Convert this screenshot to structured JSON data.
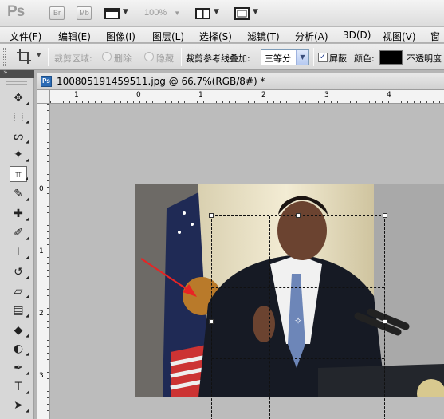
{
  "app": {
    "logo": "Ps",
    "bridge_btn": "Br",
    "minibridge_btn": "Mb",
    "zoom": "100%"
  },
  "menu": [
    "文件(F)",
    "编辑(E)",
    "图像(I)",
    "图层(L)",
    "选择(S)",
    "滤镜(T)",
    "分析(A)",
    "3D(D)",
    "视图(V)",
    "窗"
  ],
  "options": {
    "crop_area_label": "裁剪区域:",
    "delete_label": "删除",
    "hide_label": "隐藏",
    "overlay_label": "裁剪参考线叠加:",
    "overlay_value": "三等分",
    "shield_label": "屏蔽",
    "shield_checked": true,
    "color_label": "颜色:",
    "color_value": "#000000",
    "opacity_label": "不透明度"
  },
  "toolbox": {
    "collapse": "»",
    "tools": [
      {
        "name": "move-tool-icon",
        "glyph": "✥"
      },
      {
        "name": "marquee-tool-icon",
        "glyph": "⬚"
      },
      {
        "name": "lasso-tool-icon",
        "glyph": "ᔕ"
      },
      {
        "name": "quick-selection-tool-icon",
        "glyph": "✦"
      },
      {
        "name": "crop-tool-icon",
        "glyph": "⌗",
        "active": true
      },
      {
        "name": "eyedropper-tool-icon",
        "glyph": "✎"
      },
      {
        "name": "healing-brush-tool-icon",
        "glyph": "✚"
      },
      {
        "name": "brush-tool-icon",
        "glyph": "✐"
      },
      {
        "name": "clone-stamp-tool-icon",
        "glyph": "⊥"
      },
      {
        "name": "history-brush-tool-icon",
        "glyph": "↺"
      },
      {
        "name": "eraser-tool-icon",
        "glyph": "▱"
      },
      {
        "name": "gradient-tool-icon",
        "glyph": "▤"
      },
      {
        "name": "blur-tool-icon",
        "glyph": "◆"
      },
      {
        "name": "dodge-tool-icon",
        "glyph": "◐"
      },
      {
        "name": "pen-tool-icon",
        "glyph": "✒"
      },
      {
        "name": "type-tool-icon",
        "glyph": "T"
      },
      {
        "name": "path-selection-tool-icon",
        "glyph": "➤"
      },
      {
        "name": "shape-tool-icon",
        "glyph": "▭"
      }
    ]
  },
  "document": {
    "icon": "Ps",
    "title": "100805191459511.jpg @ 66.7%(RGB/8#) *",
    "h_ruler_numbers": [
      "1",
      "0",
      "1",
      "2",
      "3",
      "4"
    ],
    "v_ruler_numbers": [
      "0",
      "1",
      "2",
      "3"
    ]
  }
}
